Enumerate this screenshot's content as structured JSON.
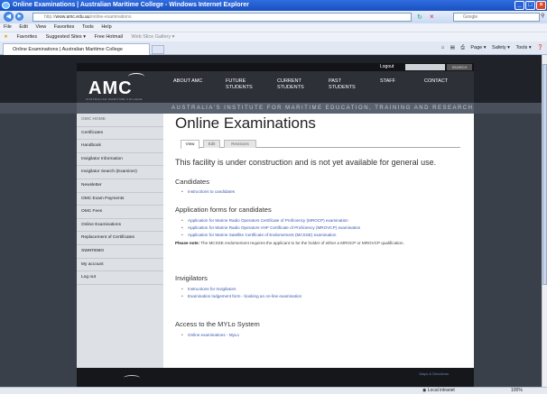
{
  "browser": {
    "title": "Online Examinations | Australian Maritime College - Windows Internet Explorer",
    "url_prefix": "http://",
    "url_domain": "www.amc.edu.au",
    "url_path": "/online-examinations",
    "search_placeholder": "Google",
    "menu": [
      "File",
      "Edit",
      "View",
      "Favorites",
      "Tools",
      "Help"
    ],
    "favorites_label": "Favorites",
    "favorites_items": [
      "Suggested Sites ▾",
      "Free Hotmail",
      "Web Slice Gallery ▾"
    ],
    "tab_title": "Online Examinations | Australian Maritime College",
    "command_items": [
      "Page ▾",
      "Safety ▾",
      "Tools ▾"
    ],
    "status_zone": "Local intranet",
    "status_zoom": "100%"
  },
  "site": {
    "logout": "Logout",
    "search_button": "SEARCH",
    "logo": "AMC",
    "logo_subtitle": "AUSTRALIAN MARITIME COLLEGE",
    "nav": [
      {
        "line1": "ABOUT AMC",
        "line2": ""
      },
      {
        "line1": "FUTURE",
        "line2": "STUDENTS"
      },
      {
        "line1": "CURRENT",
        "line2": "STUDENTS"
      },
      {
        "line1": "PAST",
        "line2": "STUDENTS"
      },
      {
        "line1": "STAFF",
        "line2": ""
      },
      {
        "line1": "CONTACT",
        "line2": ""
      }
    ],
    "tagline": "AUSTRALIA'S INSTITUTE FOR MARITIME EDUCATION, TRAINING AND RESEARCH",
    "footer_link": "Maps & Directions"
  },
  "sidebar": [
    "OMC HOME",
    "Certificates",
    "Handbook",
    "Invigilator Information",
    "Invigilator Search (Examiner)",
    "Newsletter",
    "OMC Exam Payments",
    "OMC Fees",
    "Online Examinations",
    "Replacement of Certificates",
    "SWHTEMO",
    "My account",
    "Log out"
  ],
  "content": {
    "title": "Online Examinations",
    "tabs": [
      "View",
      "Edit",
      "Revisions"
    ],
    "notice": "This facility is under construction and is not yet available for general use.",
    "candidates_heading": "Candidates",
    "candidates_links": [
      "Instructions to candidates"
    ],
    "forms_heading": "Application forms for candidates",
    "forms_links": [
      "Application for Marine Radio Operators Certificate of Proficiency (MROCP) examination",
      "Application for Marine Radio Operators VHF Certificate of Proficiency (MROVCP) examination",
      "Application for Marine Satellite Certificate of Endorsement (MCSSE) examination"
    ],
    "note_label": "Please note:",
    "note_text": " The MCSSE endorsement requires the applicant to be the holder of either a MROCP or MROVCP qualification.",
    "invigilators_heading": "Invigilators",
    "invigilators_links": [
      "Instructions for Invigilators",
      "Examination lodgement form - booking an on-line examination"
    ],
    "mylo_heading": "Access to the MYLo System",
    "mylo_links": [
      "Online examinations - MyLo"
    ]
  }
}
